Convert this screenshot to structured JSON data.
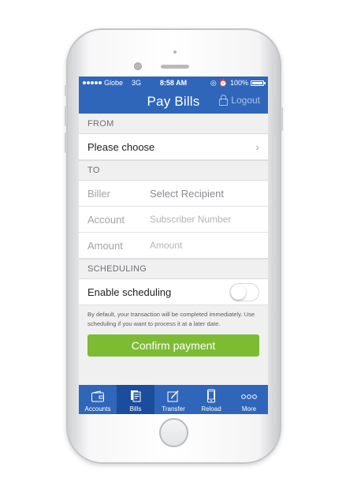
{
  "status_bar": {
    "carrier": "Globe",
    "network": "3G",
    "time": "8:58 AM",
    "battery": "100%",
    "battery_level": 1.0
  },
  "nav": {
    "title": "Pay Bills",
    "logout_label": "Logout"
  },
  "from_section": {
    "header": "FROM",
    "account_value": "Please choose"
  },
  "to_section": {
    "header": "TO",
    "biller_label": "Biller",
    "biller_placeholder": "Select Recipient",
    "account_label": "Account",
    "account_placeholder": "Subscriber Number",
    "amount_label": "Amount",
    "amount_placeholder": "Amount"
  },
  "scheduling": {
    "header": "SCHEDULING",
    "toggle_label": "Enable scheduling",
    "enabled": false,
    "note": "By default, your transaction will be completed immediately. Use scheduling if you want to process it at a later date."
  },
  "confirm_label": "Confirm payment",
  "tabs": [
    {
      "label": "Accounts",
      "icon": "wallet-icon",
      "active": false
    },
    {
      "label": "Bills",
      "icon": "bills-icon",
      "active": true
    },
    {
      "label": "Transfer",
      "icon": "transfer-icon",
      "active": false
    },
    {
      "label": "Reload",
      "icon": "phone-icon",
      "active": false
    },
    {
      "label": "More",
      "icon": "more-icon",
      "active": false
    }
  ],
  "colors": {
    "brand_blue": "#2f66b9",
    "active_tab": "#1c4d9c",
    "confirm_green": "#7dbb33"
  }
}
